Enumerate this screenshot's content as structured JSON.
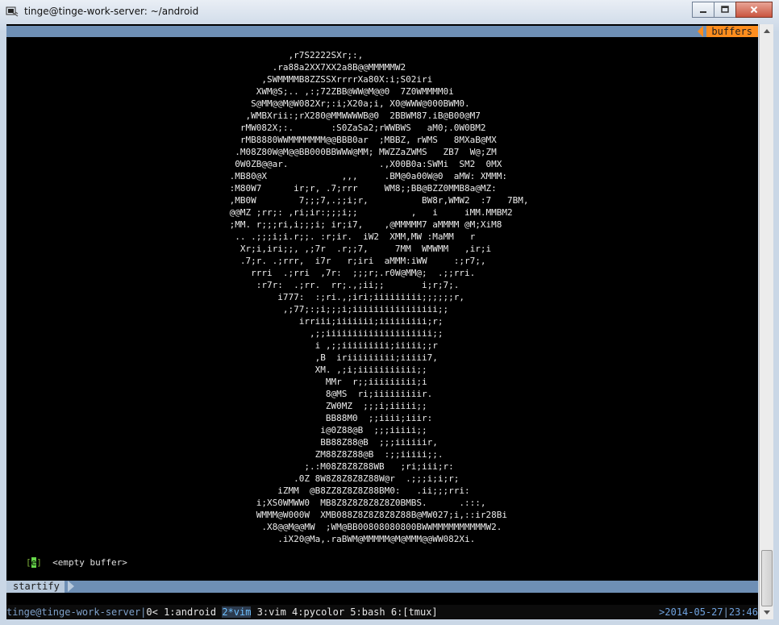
{
  "window": {
    "title": "tinge@tinge-work-server: ~/android",
    "icons": {
      "app": "terminal-icon",
      "minimize": "minimize-icon",
      "maximize": "maximize-icon",
      "close": "close-icon"
    }
  },
  "vim": {
    "tabline_label": "buffers",
    "ascii_art": "            ,r7S2222SXr;:,\n         .ra88a2XX7XX2a8B@@MMMMMW2\n       ,SWMMMMB8ZZSSXrrrrXa80X:i;S02iri\n      XWM@S;.. ,:;72ZBB@WW@M@@0  7Z0WMMMM0i\n     S@MM@@M@W082Xr;:i;X20a;i, X0@WWW@000BWM0.\n    ,WMBXrii:;rX280@MMWWWWB@0  2BBWM87.iB@B00@M7\n   rMW082X;:.       :S0ZaSa2;rWWBWS   aM0;.0W0BM2\n   rMB8880WWMMMMMMM@@BBB0ar  ;MBBZ, rWMS   8MXaB@MX\n  .M08Z80W@M@@BB000BBWWW@MM; MWZZaZWMS   ZB7  W@;ZM\n  0W0ZB@@ar.                 .,X00B0a:SWMi  SM2  0MX\n .MB80@X              ,,,     .BM@0a00W@0  aMW: XMMM:\n :M80W7      ir;r, .7;rrr     WM8;;BB@BZZ0MMB8a@MZ:\n ,MB0W        7;;;7,.;;i;r,          BW8r,WMW2  :7   7BM,\n @@MZ ;rr;: ,ri;ir:;;;i;;          ,   i     iMM.MMBM2\n ;MM. r;;;ri,i;;;i; ir;i7,    ,@MMMMM7 aMMMM @M;XiM8\n  .. .;;;i;i.r;;. :r;ir.  iW2  XMM,MW :MaMM   r\n   Xr;i,iri;;, ,;7r  .r;;7,     7MM  WMWMM   ,ir;i\n   .7;r. .;rrr,  i7r   r;iri  aMMM:iWW     :;r7;,\n     rrri  .;rri  ,7r:  ;;;r;.r0W@MM@;  .;;rri.\n      :r7r:  .;rr.  rr;.,;ii;;       i;r;7;.\n          i777:  :;ri.,;iri;iiiiiiiii;;;;;;r,\n           ,;77;:;i;;;i;iiiiiiiiiiiiiiii;;\n              irriii;iiiiiii;iiiiiiiii;r;\n                ,;;iiiiiiiiiiiiiiiiiiii;;\n                 i ,;;iiiiiiiii;iiiii;;r\n                 ,B  iriiiiiiiii;iiiii7,\n                 XM. ,;i;iiiiiiiiiii;;\n                   MMr  r;;iiiiiiiii;i\n                   8@MS  ri;iiiiiiiiir.\n                   ZW0MZ  ;;;i;iiiii;;\n                   BB88M0  ;;iiii;iiir:\n                  i@0Z88@B  ;;;iiiii;;\n                  BB88Z88@B  ;;;iiiiiir,\n                 ZM88Z8Z88@B  :;;iiiii;;.\n               ;.:M08Z8Z8Z88WB   ;ri;iii;r:\n             .0Z 8W8Z8Z8Z8Z88W@r  .;;;i;i;r;\n          iZMM  @B8ZZ8Z8Z8Z88BM0:   .ii;;;rri:\n      i;XS0WMWW0  MB8Z8Z8Z8Z8Z8Z0BMBS.      .:::,\n      WMMM@W000W  XMB088Z8Z8Z8Z8Z88B@MW027;i,::ir28Bi\n       .X8@@M@@MW  ;WM@BB00808080800BWWMMMMMMMMMMW2.\n          .iX20@Ma,.raBWM@MMMMM@M@MMM@@WW082Xi.",
    "buffer": {
      "marker_open": "[",
      "marker_char": "e",
      "marker_close": "]",
      "text": "<empty buffer>"
    },
    "status_mode": "startify"
  },
  "tmux": {
    "host": "tinge@tinge-work-server",
    "windows_prefix": "0< 1:android ",
    "current_window": "2*vim",
    "windows_suffix": " 3:vim 4:pycolor 5:bash 6:[tmux]",
    "date": ">2014-05-27",
    "time": "23:46"
  }
}
